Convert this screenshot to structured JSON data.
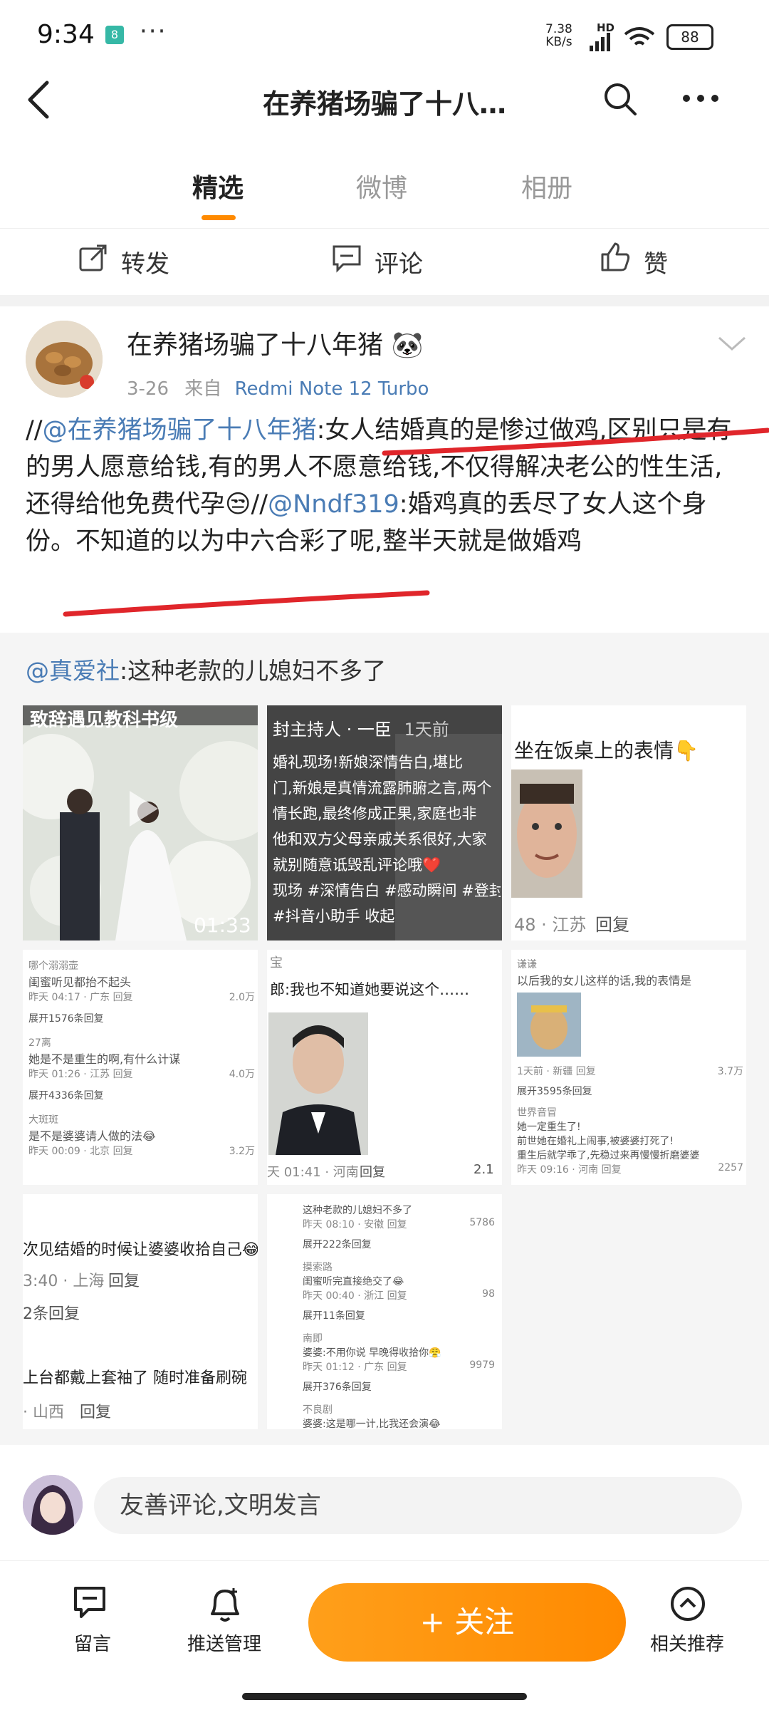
{
  "status_bar": {
    "time": "9:34",
    "badge": "8",
    "dots": "···",
    "net_speed": "7.38",
    "net_unit": "KB/s",
    "hd": "HD",
    "battery": "88"
  },
  "header": {
    "title": "在养猪场骗了十八…"
  },
  "tabs": [
    {
      "label": "精选",
      "active": true
    },
    {
      "label": "微博",
      "active": false
    },
    {
      "label": "相册",
      "active": false
    }
  ],
  "actions": {
    "repost": "转发",
    "comment": "评论",
    "like": "赞"
  },
  "post": {
    "author": "在养猪场骗了十八年猪",
    "author_emoji": "🐼",
    "date": "3-26",
    "from": "来自",
    "device": "Redmi Note 12 Turbo",
    "prefix": "//",
    "mention1": "@在养猪场骗了十八年猪",
    "text1": ":女人结婚真的是惨过做鸡,区别只是有的男人愿意给钱,有的男人不愿意给钱,不仅得解决老公的性生活,还得给他免费代孕😒//",
    "mention2": "@Nndf319",
    "text2": ":婚鸡真的丢尽了女人这个身份。不知道的以为中六合彩了呢,整半天就是做婚鸡"
  },
  "retweet": {
    "mention": "@真爱社",
    "text": ":这种老款的儿媳妇不多了"
  },
  "grid": [
    {
      "overlay_top": "致辞遇见教科书级",
      "duration": "01:33"
    },
    {
      "header": "封主持人 · 一臣",
      "time": "1天前",
      "lines": [
        "婚礼现场!新娘深情告白,堪比",
        "门,新娘是真情流露肺腑之言,两个",
        "情长跑,最终修成正果,家庭也非",
        "他和双方父母亲戚关系很好,大家",
        "就别随意诋毁乱评论哦❤️",
        "现场 #深情告白 #感动瞬间 #登封",
        "#抖音小助手  收起"
      ]
    },
    {
      "caption": "坐在饭桌上的表情👇",
      "meta": "48 · 江苏",
      "reply": "回复"
    },
    {
      "comments": [
        [
          "哪个溺溺壶",
          "闺蜜听见都抬不起头",
          "昨天 04:17 · 广东",
          "回复",
          "2.0万"
        ],
        [
          "展开1576条回复"
        ],
        [
          "27离",
          "她是不是重生的啊,有什么计谋",
          "昨天 01:26 · 江苏",
          "回复",
          "4.0万"
        ],
        [
          "展开4336条回复"
        ],
        [
          "大斑斑",
          "是不是婆婆请人做的法😂",
          "昨天 00:09 · 北京",
          "回复",
          "3.2万"
        ]
      ]
    },
    {
      "name": "宝",
      "quote": "郎:我也不知道她要说这个……",
      "meta": "天 01:41 · 河南",
      "reply": "回复",
      "likes": "2.1"
    },
    {
      "comments": [
        [
          "谦谦",
          "以后我的女儿这样的话,我的表情是",
          "1天前 · 新疆",
          "回复",
          "3.7万"
        ],
        [
          "展开3595条回复"
        ],
        [
          "世界音冒",
          "她一定重生了!",
          "前世她在婚礼上闹事,被婆婆打死了!",
          "重生后就学乖了,先稳过来再慢慢折磨婆婆",
          "昨天 09:16 · 河南",
          "回复",
          "2257"
        ]
      ]
    },
    {
      "lines": [
        "次见结婚的时候让婆婆收拾自己😂",
        "3:40 · 上海",
        "回复",
        "2条回复",
        "上台都戴上套袖了 随时准备刷碗",
        "· 山西",
        "回复"
      ]
    },
    {
      "comments": [
        [
          "这种老款的儿媳妇不多了",
          "昨天 08:10 · 安徽",
          "回复",
          "5786"
        ],
        [
          "展开222条回复"
        ],
        [
          "摸索路",
          "闺蜜听完直接绝交了😂",
          "昨天 00:40 · 浙江",
          "回复",
          "98"
        ],
        [
          "展开11条回复"
        ],
        [
          "南即",
          "婆婆:不用你说 早晚得收拾你😤",
          "昨天 01:12 · 广东",
          "回复",
          "9979"
        ],
        [
          "展开376条回复"
        ],
        [
          "不良剧",
          "婆婆:这是哪一计,比我还会演😂"
        ]
      ]
    }
  ],
  "comment_box": {
    "placeholder": "友善评论,文明发言"
  },
  "bottom_nav": {
    "message": "留言",
    "push": "推送管理",
    "follow": "+ 关注",
    "related": "相关推荐"
  },
  "colors": {
    "accent": "#ff8a00",
    "link": "#4a7cb5",
    "underline_red": "#e0262b"
  }
}
